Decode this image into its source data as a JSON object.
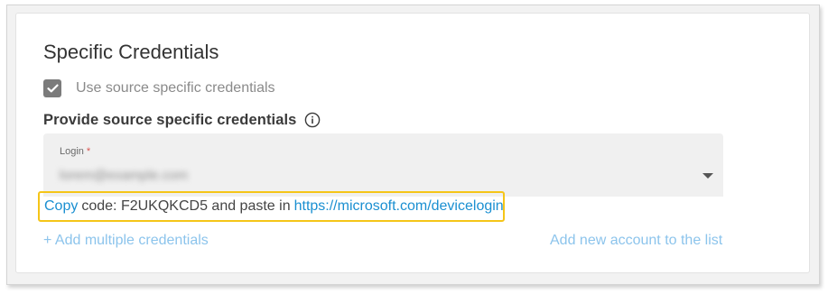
{
  "section": {
    "title": "Specific Credentials"
  },
  "checkbox": {
    "label": "Use source specific credentials",
    "checked": true
  },
  "subheader": {
    "text": "Provide source specific credentials",
    "icon": "info-icon"
  },
  "login": {
    "label": "Login",
    "required_mark": "*",
    "value": "lorem@example.com"
  },
  "device_code": {
    "copy_label": "Copy",
    "code_prefix": "code: F2UKQKCD5 and paste in",
    "url": "https://microsoft.com/devicelogin"
  },
  "footer": {
    "add_multiple": "+ Add multiple credentials",
    "add_account": "Add new account to the list"
  },
  "colors": {
    "accent": "#1a8fd1",
    "accent_muted": "#8cc4ec",
    "highlight_border": "#f5c518",
    "checkbox": "#7b7b7b"
  }
}
